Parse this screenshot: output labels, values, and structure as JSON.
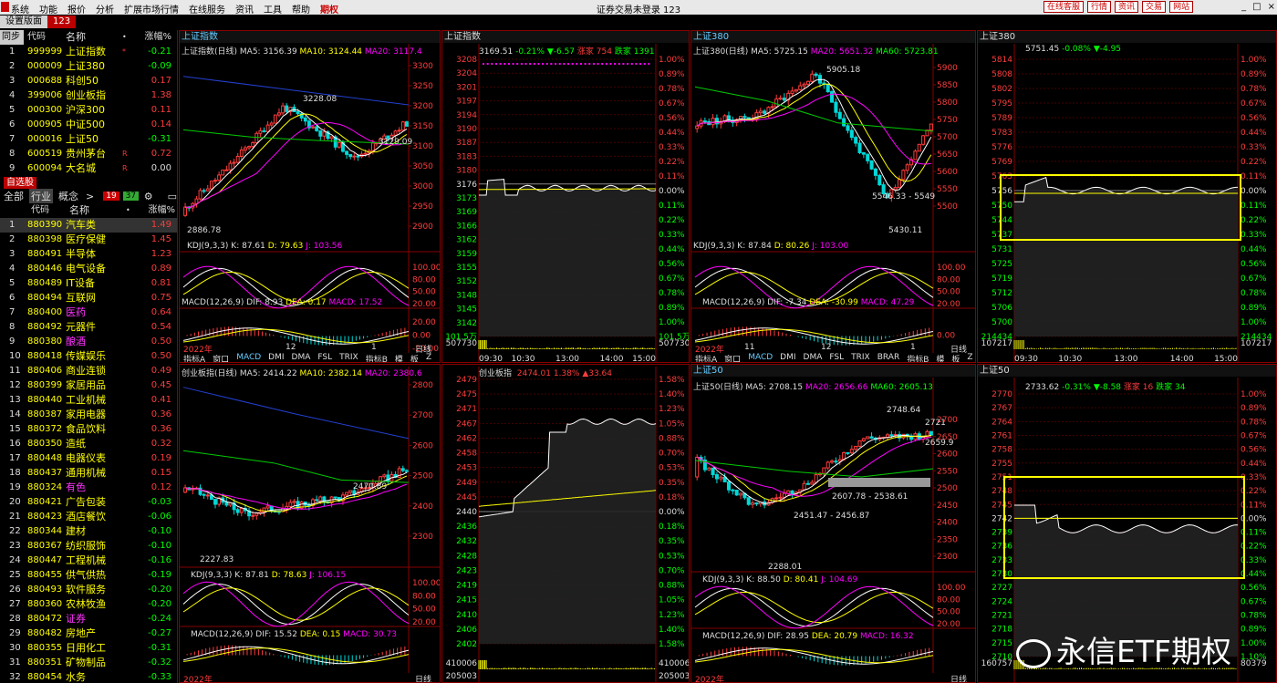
{
  "app": {
    "menus": [
      "系统",
      "功能",
      "报价",
      "分析",
      "扩展市场行情",
      "在线服务",
      "资讯",
      "工具",
      "帮助",
      "期权"
    ],
    "window_title": "证券交易未登录  123",
    "top_links": [
      "在线客服",
      "行情",
      "资讯",
      "交易",
      "网站"
    ],
    "window_buttons": [
      "_",
      "□",
      "×"
    ]
  },
  "tabs": [
    "设置版面",
    "123"
  ],
  "left": {
    "header": [
      "同步",
      "代码",
      "名称",
      "•",
      "涨幅%"
    ],
    "index_rows": [
      {
        "n": "1",
        "code": "999999",
        "name": "上证指数",
        "mark": "*",
        "pct": "-0.21",
        "dir": "dn"
      },
      {
        "n": "2",
        "code": "000009",
        "name": "上证380",
        "mark": "",
        "pct": "-0.09",
        "dir": "dn"
      },
      {
        "n": "3",
        "code": "000688",
        "name": "科创50",
        "mark": "",
        "pct": "0.17",
        "dir": "up"
      },
      {
        "n": "4",
        "code": "399006",
        "name": "创业板指",
        "mark": "",
        "pct": "1.38",
        "dir": "up"
      },
      {
        "n": "5",
        "code": "000300",
        "name": "沪深300",
        "mark": "",
        "pct": "0.11",
        "dir": "up"
      },
      {
        "n": "6",
        "code": "000905",
        "name": "中证500",
        "mark": "",
        "pct": "0.14",
        "dir": "up"
      },
      {
        "n": "7",
        "code": "000016",
        "name": "上证50",
        "mark": "",
        "pct": "-0.31",
        "dir": "dn"
      },
      {
        "n": "8",
        "code": "600519",
        "name": "贵州茅台",
        "mark": "R",
        "pct": "0.72",
        "dir": "up"
      },
      {
        "n": "9",
        "code": "600094",
        "name": "大名城",
        "mark": "R",
        "pct": "0.00",
        "dir": "fl"
      }
    ],
    "self_select_label": "自选股",
    "filter": {
      "all": "全部",
      "industry": "行业",
      "concept": "概念",
      "arrow": ">",
      "count_up": "19",
      "count_down": "37",
      "gear": "⚙",
      "pin": "▭"
    },
    "header2": [
      "",
      "代码",
      "名称",
      "•",
      "涨幅%"
    ],
    "industry_rows": [
      {
        "n": "1",
        "code": "880390",
        "name": "汽车类",
        "pct": "1.49",
        "dir": "up",
        "name_color": "#ff0"
      },
      {
        "n": "2",
        "code": "880398",
        "name": "医疗保健",
        "pct": "1.45",
        "dir": "up",
        "name_color": "#ff0"
      },
      {
        "n": "3",
        "code": "880491",
        "name": "半导体",
        "pct": "1.23",
        "dir": "up",
        "name_color": "#ff0"
      },
      {
        "n": "4",
        "code": "880446",
        "name": "电气设备",
        "pct": "0.89",
        "dir": "up",
        "name_color": "#ff0"
      },
      {
        "n": "5",
        "code": "880489",
        "name": "IT设备",
        "pct": "0.81",
        "dir": "up",
        "name_color": "#ff0"
      },
      {
        "n": "6",
        "code": "880494",
        "name": "互联网",
        "pct": "0.75",
        "dir": "up",
        "name_color": "#ff0"
      },
      {
        "n": "7",
        "code": "880400",
        "name": "医药",
        "pct": "0.64",
        "dir": "up",
        "name_color": "#f3f"
      },
      {
        "n": "8",
        "code": "880492",
        "name": "元器件",
        "pct": "0.54",
        "dir": "up",
        "name_color": "#ff0"
      },
      {
        "n": "9",
        "code": "880380",
        "name": "酿酒",
        "pct": "0.50",
        "dir": "up",
        "name_color": "#f3f"
      },
      {
        "n": "10",
        "code": "880418",
        "name": "传媒娱乐",
        "pct": "0.50",
        "dir": "up",
        "name_color": "#ff0"
      },
      {
        "n": "11",
        "code": "880406",
        "name": "商业连锁",
        "pct": "0.49",
        "dir": "up",
        "name_color": "#ff0"
      },
      {
        "n": "12",
        "code": "880399",
        "name": "家居用品",
        "pct": "0.45",
        "dir": "up",
        "name_color": "#ff0"
      },
      {
        "n": "13",
        "code": "880440",
        "name": "工业机械",
        "pct": "0.41",
        "dir": "up",
        "name_color": "#ff0"
      },
      {
        "n": "14",
        "code": "880387",
        "name": "家用电器",
        "pct": "0.36",
        "dir": "up",
        "name_color": "#ff0"
      },
      {
        "n": "15",
        "code": "880372",
        "name": "食品饮料",
        "pct": "0.36",
        "dir": "up",
        "name_color": "#ff0"
      },
      {
        "n": "16",
        "code": "880350",
        "name": "造纸",
        "pct": "0.32",
        "dir": "up",
        "name_color": "#ff0"
      },
      {
        "n": "17",
        "code": "880448",
        "name": "电器仪表",
        "pct": "0.19",
        "dir": "up",
        "name_color": "#ff0"
      },
      {
        "n": "18",
        "code": "880437",
        "name": "通用机械",
        "pct": "0.15",
        "dir": "up",
        "name_color": "#ff0"
      },
      {
        "n": "19",
        "code": "880324",
        "name": "有色",
        "pct": "0.12",
        "dir": "up",
        "name_color": "#f3f"
      },
      {
        "n": "20",
        "code": "880421",
        "name": "广告包装",
        "pct": "-0.03",
        "dir": "dn",
        "name_color": "#ff0"
      },
      {
        "n": "21",
        "code": "880423",
        "name": "酒店餐饮",
        "pct": "-0.06",
        "dir": "dn",
        "name_color": "#ff0"
      },
      {
        "n": "22",
        "code": "880344",
        "name": "建材",
        "pct": "-0.10",
        "dir": "dn",
        "name_color": "#ff0"
      },
      {
        "n": "23",
        "code": "880367",
        "name": "纺织服饰",
        "pct": "-0.10",
        "dir": "dn",
        "name_color": "#ff0"
      },
      {
        "n": "24",
        "code": "880447",
        "name": "工程机械",
        "pct": "-0.16",
        "dir": "dn",
        "name_color": "#ff0"
      },
      {
        "n": "25",
        "code": "880455",
        "name": "供气供热",
        "pct": "-0.19",
        "dir": "dn",
        "name_color": "#ff0"
      },
      {
        "n": "26",
        "code": "880493",
        "name": "软件服务",
        "pct": "-0.20",
        "dir": "dn",
        "name_color": "#ff0"
      },
      {
        "n": "27",
        "code": "880360",
        "name": "农林牧渔",
        "pct": "-0.20",
        "dir": "dn",
        "name_color": "#ff0"
      },
      {
        "n": "28",
        "code": "880472",
        "name": "证券",
        "pct": "-0.24",
        "dir": "dn",
        "name_color": "#f3f"
      },
      {
        "n": "29",
        "code": "880482",
        "name": "房地产",
        "pct": "-0.27",
        "dir": "dn",
        "name_color": "#ff0"
      },
      {
        "n": "30",
        "code": "880355",
        "name": "日用化工",
        "pct": "-0.31",
        "dir": "dn",
        "name_color": "#ff0"
      },
      {
        "n": "31",
        "code": "880351",
        "name": "矿物制品",
        "pct": "-0.32",
        "dir": "dn",
        "name_color": "#ff0"
      },
      {
        "n": "32",
        "code": "880454",
        "name": "水务",
        "pct": "-0.33",
        "dir": "dn",
        "name_color": "#ff0"
      }
    ]
  },
  "colors": {
    "up": "#ff3c3c",
    "down": "#00ff00",
    "border": "#880000",
    "highlight": "#ffff00"
  },
  "panels": {
    "k1": {
      "tab": "上证指数",
      "info": {
        "name": "上证指数(日线)",
        "ma5": "MA5: 3156.39",
        "ma10": "MA10: 3124.44",
        "ma20": "MA20: 3117.4"
      },
      "price_ticks": [
        "3300",
        "3250",
        "3200",
        "3150",
        "3100",
        "3050",
        "3000",
        "2950",
        "2900"
      ],
      "labels": [
        "3228.08",
        "3129.09",
        "2886.78"
      ],
      "kdj": {
        "label": "KDJ(9,3,3)",
        "k": "K: 87.61",
        "d": "D: 79.63",
        "j": "J: 103.56"
      },
      "kdj_ticks": [
        "100.00",
        "80.00",
        "50.00",
        "20.00"
      ],
      "macd": {
        "label": "MACD(12,26,9)",
        "dif": "DIF: 8.93",
        "dea": "DEA: 0.17",
        "macd": "MACD: 17.52"
      },
      "macd_ticks": [
        "20.00",
        "0.00",
        "-20.00"
      ],
      "bottom_left": "2022年",
      "bottom_months": [
        "12",
        "1"
      ],
      "bottom_right": "日线",
      "tabstrip": [
        "指标A",
        "窗口",
        "MACD",
        "DMI",
        "DMA",
        "FSL",
        "TRIX",
        "指标B",
        "模",
        "板",
        "Z"
      ]
    },
    "t1": {
      "tab": "上证指数",
      "info": {
        "price": "3169.51",
        "chg": "-0.21%",
        "vol": "▼-6.57",
        "up": "涨家 754",
        "down": "跌家 1391"
      },
      "left_ticks": [
        "3208",
        "3204",
        "3201",
        "3197",
        "3194",
        "3190",
        "3187",
        "3183",
        "3180",
        "3176",
        "3173",
        "3169",
        "3166",
        "3162",
        "3159",
        "3155",
        "3152",
        "3148",
        "3145",
        "3142",
        "101.5万"
      ],
      "right_ticks": [
        "1.00%",
        "0.89%",
        "0.78%",
        "0.67%",
        "0.56%",
        "0.44%",
        "0.33%",
        "0.22%",
        "0.11%",
        "0.00%",
        "0.11%",
        "0.22%",
        "0.33%",
        "0.44%",
        "0.56%",
        "0.67%",
        "0.78%",
        "0.89%",
        "1.00%",
        "101.5万"
      ],
      "vol_left": "507730",
      "vol_right": "507730",
      "times": [
        "09:30",
        "10:30",
        "13:00",
        "14:00",
        "15:00"
      ]
    },
    "k2": {
      "tab": "上证380",
      "info": {
        "name": "上证380(日线)",
        "ma5": "MA5: 5725.15",
        "ma20": "MA20: 5651.32",
        "ma60": "MA60: 5723.81"
      },
      "price_ticks": [
        "5900",
        "5850",
        "5800",
        "5750",
        "5700",
        "5650",
        "5600",
        "5550",
        "5500"
      ],
      "labels": [
        "5905.18",
        "5546.33 - 5549",
        "5430.11"
      ],
      "kdj": {
        "label": "KDJ(9,3,3)",
        "k": "K: 87.84",
        "d": "D: 80.26",
        "j": "J: 103.00"
      },
      "kdj_ticks": [
        "100.00",
        "80.00",
        "50.00",
        "20.00"
      ],
      "macd": {
        "label": "MACD(12,26,9)",
        "dif": "DIF: -7.34",
        "dea": "DEA: -30.99",
        "macd": "MACD: 47.29"
      },
      "macd_ticks": [
        "0.00"
      ],
      "bottom_left": "2022年",
      "bottom_months": [
        "11",
        "12",
        "1"
      ],
      "bottom_right": "日线",
      "tabstrip": [
        "指标A",
        "窗口",
        "MACD",
        "DMI",
        "DMA",
        "FSL",
        "TRIX",
        "BRAR",
        "指标B",
        "模",
        "板",
        "Z"
      ]
    },
    "t2": {
      "tab": "上证380",
      "info": {
        "price": "5751.45",
        "chg": "-0.08%",
        "vol": "▼-4.95"
      },
      "left_ticks": [
        "5814",
        "5808",
        "5802",
        "5795",
        "5789",
        "5783",
        "5776",
        "5769",
        "5763",
        "5756",
        "5750",
        "5744",
        "5737",
        "5731",
        "5725",
        "5719",
        "5712",
        "5706",
        "5700",
        "214434"
      ],
      "right_ticks": [
        "1.00%",
        "0.89%",
        "0.78%",
        "0.67%",
        "0.56%",
        "0.44%",
        "0.33%",
        "0.22%",
        "0.11%",
        "0.00%",
        "0.11%",
        "0.22%",
        "0.33%",
        "0.44%",
        "0.56%",
        "0.67%",
        "0.78%",
        "0.89%",
        "1.00%",
        "214434"
      ],
      "vol_left": "107217",
      "vol_right": "107217",
      "times": [
        "09:30",
        "10:30",
        "13:00",
        "14:00",
        "15:00"
      ]
    },
    "k3": {
      "tab": "创业板指",
      "info": {
        "name": "创业板指(日线)",
        "ma5": "MA5: 2414.22",
        "ma10": "MA10: 2382.14",
        "ma20": "MA20: 2380.6"
      },
      "price_ticks": [
        "2800",
        "2700",
        "2600",
        "2500",
        "2400",
        "2300"
      ],
      "labels": [
        "2470.89",
        "2227.83"
      ],
      "kdj": {
        "label": "KDJ(9,3,3)",
        "k": "K: 87.81",
        "d": "D: 78.63",
        "j": "J: 106.15"
      },
      "kdj_ticks": [
        "100.00",
        "80.00",
        "50.00",
        "20.00"
      ],
      "macd": {
        "label": "MACD(12,26,9)",
        "dif": "DIF: 15.52",
        "dea": "DEA: 0.15",
        "macd": "MACD: 30.73"
      },
      "bottom_left": "2022年",
      "bottom_right": "日线"
    },
    "t3": {
      "tab": "创业板指",
      "info": {
        "price": "2474.01",
        "chg": "1.38%",
        "vol": "▲33.64"
      },
      "left_ticks": [
        "2479",
        "2475",
        "2471",
        "2467",
        "2462",
        "2458",
        "2453",
        "2449",
        "2445",
        "2440",
        "2436",
        "2432",
        "2428",
        "2423",
        "2419",
        "2415",
        "2410",
        "2406",
        "2402"
      ],
      "right_ticks": [
        "1.58%",
        "1.40%",
        "1.23%",
        "1.05%",
        "0.88%",
        "0.70%",
        "0.53%",
        "0.35%",
        "0.18%",
        "0.00%",
        "0.18%",
        "0.35%",
        "0.53%",
        "0.70%",
        "0.88%",
        "1.05%",
        "1.23%",
        "1.40%",
        "1.58%"
      ],
      "vol_left": "410006",
      "vol_right": "410006",
      "vol_left2": "205003",
      "vol_right2": "205003"
    },
    "k4": {
      "tab": "上证50",
      "info": {
        "name": "上证50(日线)",
        "ma5": "MA5: 2708.15",
        "ma20": "MA20: 2656.66",
        "ma60": "MA60: 2605.13"
      },
      "price_ticks": [
        "2700",
        "2650",
        "2600",
        "2550",
        "2500",
        "2450",
        "2400",
        "2350",
        "2300"
      ],
      "labels": [
        "2748.64",
        "2721",
        "2659.9",
        "2607.78 - 2538.61",
        "2451.47 - 2456.87",
        "2288.01"
      ],
      "kdj": {
        "label": "KDJ(9,3,3)",
        "k": "K: 88.50",
        "d": "D: 80.41",
        "j": "J: 104.69"
      },
      "kdj_ticks": [
        "100.00",
        "80.00",
        "50.00",
        "20.00"
      ],
      "macd": {
        "label": "MACD(12,26,9)",
        "dif": "DIF: 28.95",
        "dea": "DEA: 20.79",
        "macd": "MACD: 16.32"
      },
      "bottom_left": "2022年",
      "bottom_right": "日线"
    },
    "t4": {
      "tab": "上证50",
      "info": {
        "price": "2733.62",
        "chg": "-0.31%",
        "vol": "▼-8.58",
        "up": "涨家 16",
        "down": "跌家 34"
      },
      "left_ticks": [
        "2770",
        "2767",
        "2764",
        "2761",
        "2758",
        "2755",
        "2751",
        "2748",
        "2745",
        "2742",
        "2739",
        "2736",
        "2733",
        "2730",
        "2727",
        "2724",
        "2721",
        "2718",
        "2715",
        "2710"
      ],
      "right_ticks": [
        "1.00%",
        "0.89%",
        "0.78%",
        "0.67%",
        "0.56%",
        "0.44%",
        "0.33%",
        "0.22%",
        "0.11%",
        "0.00%",
        "0.11%",
        "0.22%",
        "0.33%",
        "0.44%",
        "0.56%",
        "0.67%",
        "0.78%",
        "0.89%",
        "1.00%",
        "1.10%"
      ],
      "vol_left": "160757",
      "vol_right": "80379"
    }
  },
  "watermark": "永信ETF期权"
}
